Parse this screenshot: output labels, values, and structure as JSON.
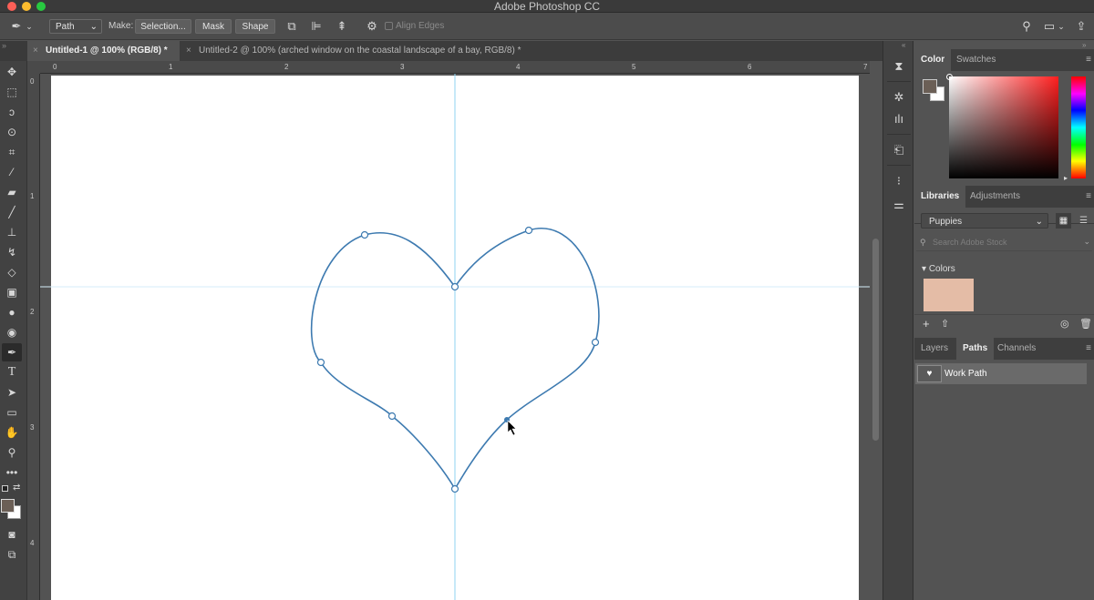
{
  "app": {
    "title": "Adobe Photoshop CC"
  },
  "options_bar": {
    "tool_mode": "Path",
    "make_label": "Make:",
    "selection_button": "Selection...",
    "mask_button": "Mask",
    "shape_button": "Shape",
    "align_edges_label": "Align Edges"
  },
  "document_tabs": [
    {
      "label": "Untitled-1 @ 100% (RGB/8) *",
      "active": true
    },
    {
      "label": "Untitled-2 @ 100% (arched window on the coastal landscape of a bay, RGB/8) *",
      "active": false
    }
  ],
  "rulers": {
    "horizontal": [
      "0",
      "1",
      "2",
      "3",
      "4",
      "5",
      "6",
      "7"
    ],
    "vertical": [
      "0",
      "1",
      "2",
      "3",
      "4"
    ]
  },
  "tools": [
    "move-icon",
    "marquee-icon",
    "lasso-icon",
    "quick-select-icon",
    "crop-icon",
    "eyedropper-icon",
    "healing-icon",
    "brush-icon",
    "stamp-icon",
    "history-brush-icon",
    "eraser-icon",
    "gradient-icon",
    "blur-icon",
    "dodge-icon",
    "pen-icon",
    "type-icon",
    "path-select-icon",
    "rectangle-icon",
    "hand-icon",
    "zoom-icon",
    "more-icon"
  ],
  "colors": {
    "foreground": "#6b5f56",
    "background": "#ffffff",
    "path_stroke": "#3d7ab0",
    "guide": "#8fd3f0",
    "library_swatch": "#e4bca6"
  },
  "color_panel": {
    "tabs": [
      {
        "label": "Color",
        "active": true
      },
      {
        "label": "Swatches",
        "active": false
      }
    ]
  },
  "libraries_panel": {
    "tabs": [
      {
        "label": "Libraries",
        "active": true
      },
      {
        "label": "Adjustments",
        "active": false
      }
    ],
    "library": "Puppies",
    "search_placeholder": "Search Adobe Stock",
    "section": "Colors"
  },
  "layers_panel": {
    "tabs": [
      {
        "label": "Layers",
        "active": false
      },
      {
        "label": "Paths",
        "active": true
      },
      {
        "label": "Channels",
        "active": false
      }
    ],
    "paths": [
      {
        "name": "Work Path"
      }
    ]
  }
}
